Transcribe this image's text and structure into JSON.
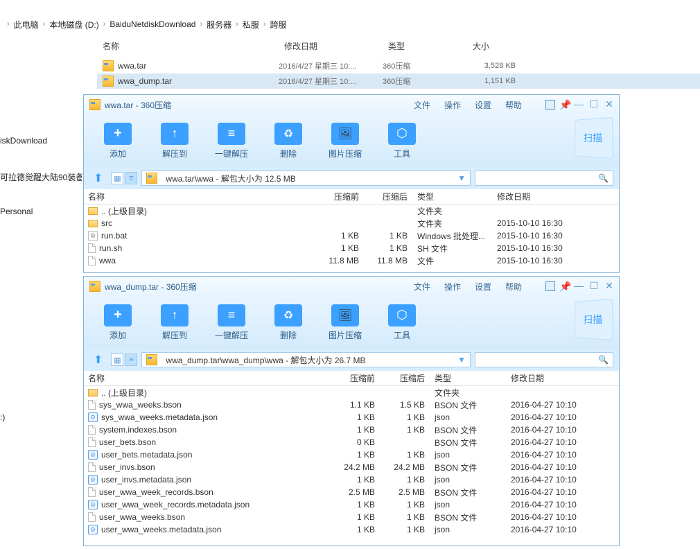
{
  "breadcrumb": [
    "此电脑",
    "本地磁盘 (D:)",
    "BaiduNetdiskDownload",
    "服务器",
    "私服",
    "跨服"
  ],
  "explorer": {
    "columns": {
      "name": "名称",
      "date": "修改日期",
      "type": "类型",
      "size": "大小"
    },
    "rows": [
      {
        "name": "wwa.tar",
        "date": "2016/4/27 星期三 10:...",
        "type": "360压缩",
        "size": "3,528 KB",
        "selected": false
      },
      {
        "name": "wwa_dump.tar",
        "date": "2016/4/27 星期三 10:...",
        "type": "360压缩",
        "size": "1,151 KB",
        "selected": true
      }
    ]
  },
  "sidebar": {
    "disk_dl": "iskDownload",
    "realm": "可拉德觉醒大陆90装备",
    "personal": "Personal",
    "colon": ":)"
  },
  "archive": {
    "menus": {
      "file": "文件",
      "operate": "操作",
      "settings": "设置",
      "help": "帮助"
    },
    "toolbar": {
      "add": "添加",
      "extract": "解压到",
      "oneclick": "一键解压",
      "delete": "删除",
      "imgcomp": "图片压缩",
      "tools": "工具",
      "scan": "扫描"
    },
    "columns": {
      "name": "名称",
      "before": "压缩前",
      "after": "压缩后",
      "type": "类型",
      "date": "修改日期"
    },
    "parent": ".. (上级目录)",
    "parent_type": "文件夹"
  },
  "win1": {
    "title": "wwa.tar - 360压缩",
    "path": "wwa.tar\\wwa - 解包大小为 12.5 MB",
    "rows": [
      {
        "icon": "folder",
        "name": "src",
        "before": "",
        "after": "",
        "type": "文件夹",
        "date": "2015-10-10 16:30"
      },
      {
        "icon": "bat",
        "name": "run.bat",
        "before": "1 KB",
        "after": "1 KB",
        "type": "Windows 批处理...",
        "date": "2015-10-10 16:30"
      },
      {
        "icon": "file",
        "name": "run.sh",
        "before": "1 KB",
        "after": "1 KB",
        "type": "SH 文件",
        "date": "2015-10-10 16:30"
      },
      {
        "icon": "file",
        "name": "wwa",
        "before": "11.8 MB",
        "after": "11.8 MB",
        "type": "文件",
        "date": "2015-10-10 16:30"
      }
    ]
  },
  "win2": {
    "title": "wwa_dump.tar - 360压缩",
    "path": "wwa_dump.tar\\wwa_dump\\wwa - 解包大小为 26.7 MB",
    "rows": [
      {
        "icon": "file",
        "name": "sys_wwa_weeks.bson",
        "before": "1.1 KB",
        "after": "1.5 KB",
        "type": "BSON 文件",
        "date": "2016-04-27 10:10"
      },
      {
        "icon": "json",
        "name": "sys_wwa_weeks.metadata.json",
        "before": "1 KB",
        "after": "1 KB",
        "type": "json",
        "date": "2016-04-27 10:10"
      },
      {
        "icon": "file",
        "name": "system.indexes.bson",
        "before": "1 KB",
        "after": "1 KB",
        "type": "BSON 文件",
        "date": "2016-04-27 10:10"
      },
      {
        "icon": "file",
        "name": "user_bets.bson",
        "before": "0 KB",
        "after": "",
        "type": "BSON 文件",
        "date": "2016-04-27 10:10"
      },
      {
        "icon": "json",
        "name": "user_bets.metadata.json",
        "before": "1 KB",
        "after": "1 KB",
        "type": "json",
        "date": "2016-04-27 10:10"
      },
      {
        "icon": "file",
        "name": "user_invs.bson",
        "before": "24.2 MB",
        "after": "24.2 MB",
        "type": "BSON 文件",
        "date": "2016-04-27 10:10"
      },
      {
        "icon": "json",
        "name": "user_invs.metadata.json",
        "before": "1 KB",
        "after": "1 KB",
        "type": "json",
        "date": "2016-04-27 10:10"
      },
      {
        "icon": "file",
        "name": "user_wwa_week_records.bson",
        "before": "2.5 MB",
        "after": "2.5 MB",
        "type": "BSON 文件",
        "date": "2016-04-27 10:10"
      },
      {
        "icon": "json",
        "name": "user_wwa_week_records.metadata.json",
        "before": "1 KB",
        "after": "1 KB",
        "type": "json",
        "date": "2016-04-27 10:10"
      },
      {
        "icon": "file",
        "name": "user_wwa_weeks.bson",
        "before": "1 KB",
        "after": "1 KB",
        "type": "BSON 文件",
        "date": "2016-04-27 10:10"
      },
      {
        "icon": "json",
        "name": "user_wwa_weeks.metadata.json",
        "before": "1 KB",
        "after": "1 KB",
        "type": "json",
        "date": "2016-04-27 10:10"
      }
    ]
  }
}
